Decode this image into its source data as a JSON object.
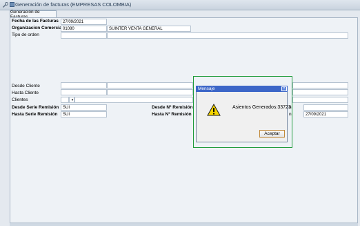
{
  "window": {
    "title": "Generación de facturas (EMPRESAS COLOMBIA)"
  },
  "tabs": [
    {
      "label": "Generación de Facturas"
    }
  ],
  "form": {
    "fecha_facturas": {
      "label": "Fecha de las Facturas",
      "value": "27/09/2021"
    },
    "organizacion": {
      "label": "Organizacion Comercial",
      "code": "01080",
      "name": "SUINTER VENTA GENERAL"
    },
    "tipo_orden": {
      "label": "Tipo de orden",
      "value": ""
    },
    "desde_cliente": {
      "label": "Desde Cliente",
      "value": ""
    },
    "hasta_cliente": {
      "label": "Hasta Cliente",
      "value": ""
    },
    "clientes": {
      "label": "Clientes",
      "value": ""
    },
    "desde_serie": {
      "label": "Desde Serie Remisión",
      "value": "SUI"
    },
    "hasta_serie": {
      "label": "Hasta Serie Remisión",
      "value": "SUI"
    },
    "desde_num": {
      "label": "Desde Nº Remisión",
      "suffix": "n",
      "value": ""
    },
    "hasta_num": {
      "label": "Hasta Nº Remisión",
      "suffix": "n",
      "value": "27/09/2021"
    }
  },
  "dialog": {
    "title": "Mensaje",
    "message": "Asientos Generados:33723",
    "ok_label": "Aceptar",
    "icon": "warning-icon"
  }
}
